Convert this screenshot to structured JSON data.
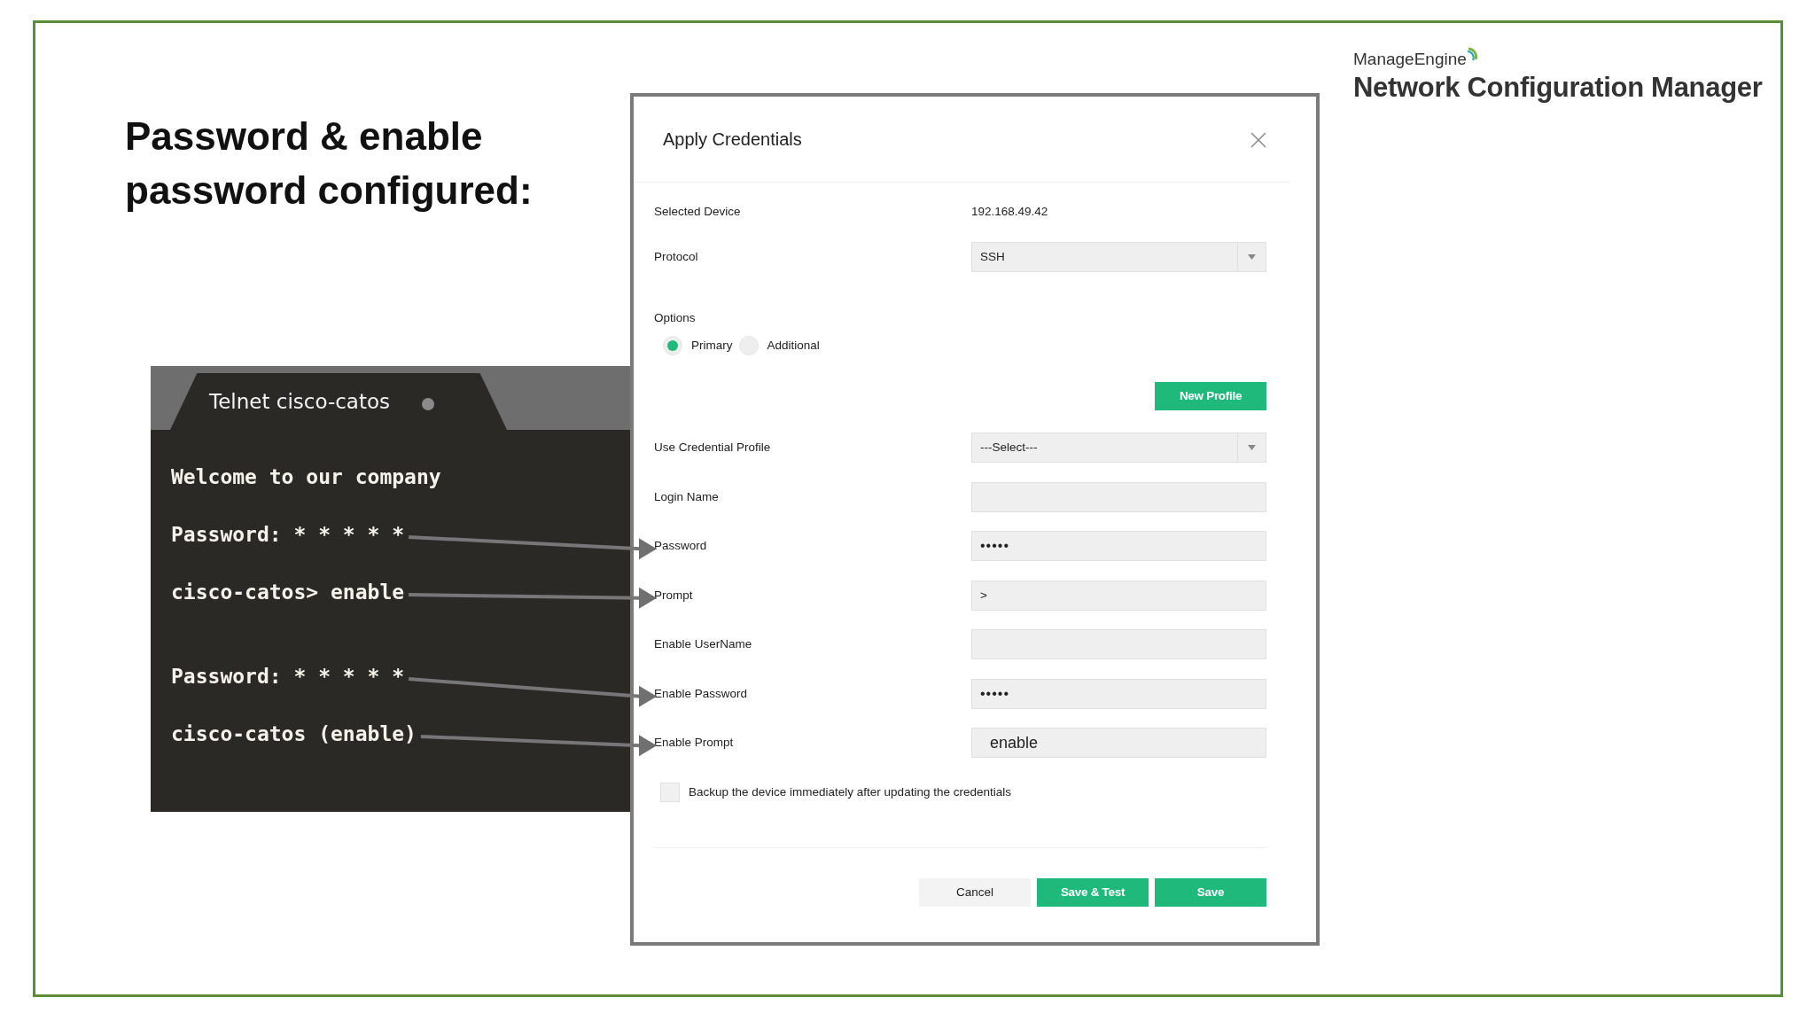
{
  "slide": {
    "heading": "Password & enable password configured:",
    "logo": {
      "brand": "ManageEngine",
      "product": "Network Configuration Manager"
    }
  },
  "terminal": {
    "tab_title": "Telnet cisco-catos",
    "lines": [
      {
        "text": "Welcome to our company",
        "arrow": false,
        "spaced": false
      },
      {
        "text": "Password: * * * * *",
        "arrow": true,
        "spaced": false
      },
      {
        "text": "cisco-catos> enable",
        "arrow": true,
        "spaced": false
      },
      {
        "text": "Password: * * * * *",
        "arrow": true,
        "spaced": true
      },
      {
        "text": "cisco-catos (enable)",
        "arrow": true,
        "spaced": false
      }
    ]
  },
  "dialog": {
    "title": "Apply Credentials",
    "device": {
      "label": "Selected Device",
      "value": "192.168.49.42"
    },
    "protocol": {
      "label": "Protocol",
      "value": "SSH"
    },
    "options": {
      "label": "Options",
      "radios": [
        {
          "label": "Primary",
          "selected": true
        },
        {
          "label": "Additional",
          "selected": false
        }
      ]
    },
    "new_profile_button": "New Profile",
    "fields": [
      {
        "label": "Use Credential Profile",
        "kind": "select",
        "value": "---Select---",
        "arrow_target": false
      },
      {
        "label": "Login Name",
        "kind": "input",
        "arrow_target": false
      },
      {
        "label": "Password",
        "kind": "masked",
        "value": "•••••",
        "arrow_target": true
      },
      {
        "label": "Prompt",
        "kind": "input",
        "value": ">",
        "arrow_target": true
      },
      {
        "label": "Enable UserName",
        "kind": "input",
        "arrow_target": false
      },
      {
        "label": "Enable Password",
        "kind": "masked",
        "value": "•••••",
        "arrow_target": true
      },
      {
        "label": "Enable Prompt",
        "kind": "large",
        "value": "enable",
        "arrow_target": true
      }
    ],
    "backup": {
      "label": "Backup the device immediately after updating the credentials",
      "checked": false
    },
    "buttons": [
      {
        "label": "Cancel",
        "kind": "secondary"
      },
      {
        "label": "Save & Test",
        "kind": "primary"
      },
      {
        "label": "Save",
        "kind": "primary"
      }
    ]
  }
}
